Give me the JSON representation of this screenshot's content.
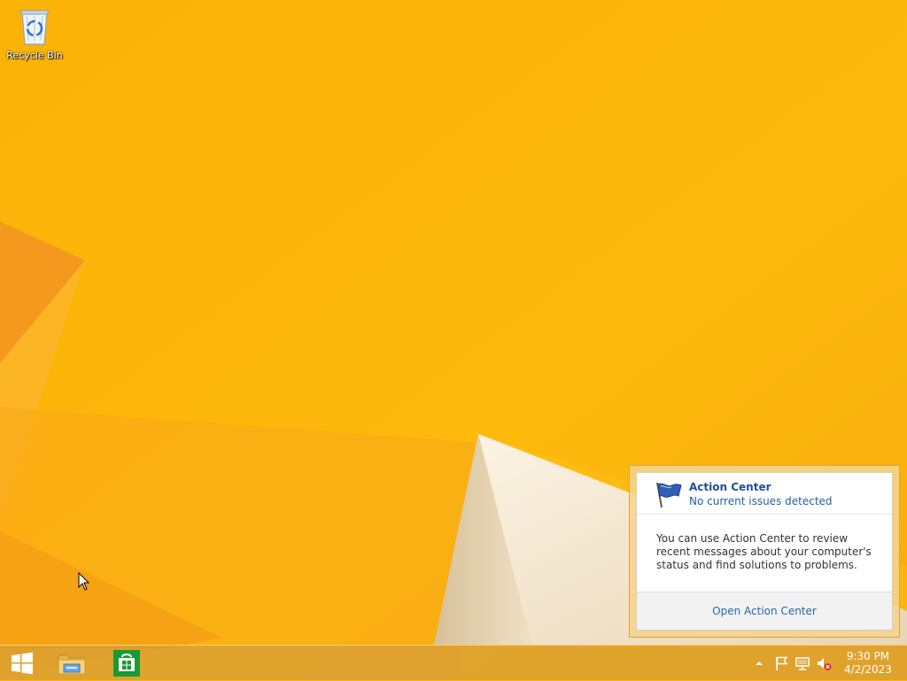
{
  "desktop": {
    "icons": [
      {
        "label": "Recycle Bin",
        "icon": "recycle-bin-icon"
      }
    ]
  },
  "colors": {
    "wallpaper": "#fbb40a",
    "wallpaper_light": "#ffc812",
    "wallpaper_orange": "#f39a17",
    "taskbar": "#daa034",
    "accent_blue": "#1e4f94",
    "store_green": "#1a9a33"
  },
  "taskbar": {
    "pinned": [
      {
        "name": "Start",
        "icon": "windows-logo-icon"
      },
      {
        "name": "File Explorer",
        "icon": "folder-icon"
      },
      {
        "name": "Store",
        "icon": "store-bag-icon"
      }
    ],
    "tray": {
      "icons": [
        "show-hidden-icons-chevron-icon",
        "action-center-flag-icon",
        "network-icon",
        "volume-muted-icon"
      ],
      "clock": {
        "time": "9:30 PM",
        "date": "4/2/2023"
      }
    }
  },
  "action_center": {
    "title": "Action Center",
    "status": "No current issues detected",
    "body": "You can use Action Center to review recent messages about your computer's status and find solutions to problems.",
    "link": "Open Action Center"
  }
}
